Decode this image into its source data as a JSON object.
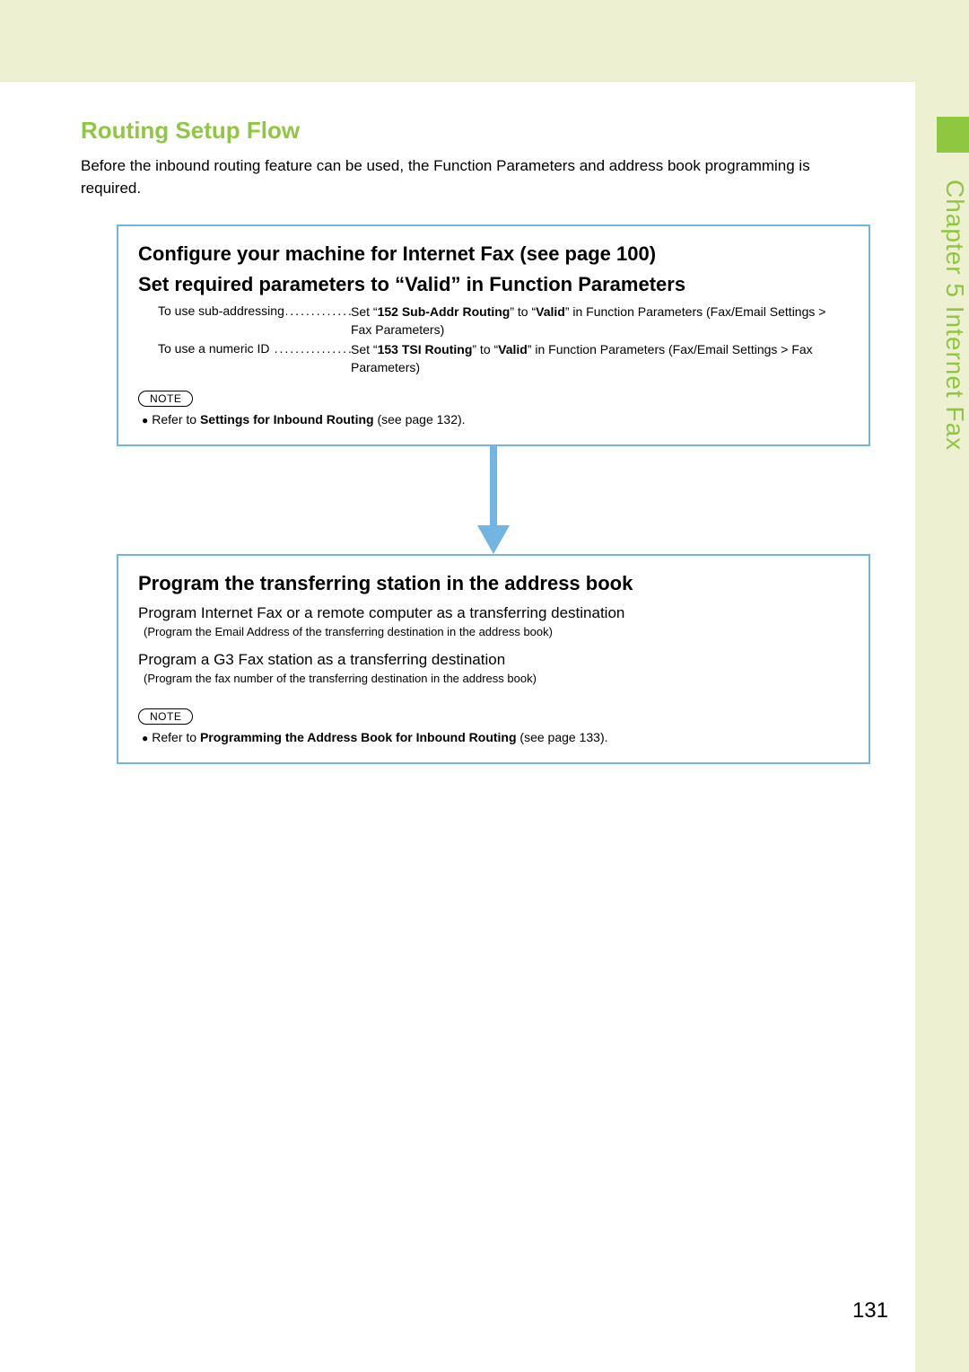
{
  "chapter_label": "Chapter 5   Internet Fax",
  "section_title": "Routing Setup Flow",
  "intro": "Before the inbound routing feature can be used, the Function Parameters and address book programming is required.",
  "box1": {
    "h1": "Configure your machine for Internet Fax (see page 100)",
    "h2": "Set required parameters to “Valid” in Function Parameters",
    "row1_left": "To use sub-addressing",
    "row1_right_pre": "Set “",
    "row1_right_bold": "152 Sub-Addr Routing",
    "row1_right_mid": "” to “",
    "row1_right_bold2": "Valid",
    "row1_right_post": "” in Function Parameters (Fax/Email Settings > Fax Parameters)",
    "row2_left": "To use a numeric ID",
    "row2_right_pre": "Set “",
    "row2_right_bold": "153 TSI Routing",
    "row2_right_mid": "” to “",
    "row2_right_bold2": "Valid",
    "row2_right_post": "” in Function Parameters (Fax/Email Settings > Fax Parameters)",
    "note_label": "NOTE",
    "note_pre": "Refer to ",
    "note_bold": "Settings for Inbound Routing",
    "note_post": " (see page 132)."
  },
  "box2": {
    "h1": "Program the transferring station in the address book",
    "line1": "Program Internet Fax or a remote computer as a transferring destination",
    "sub1": "(Program the Email Address of the transferring destination in the address book)",
    "line2": "Program a G3 Fax station as a transferring destination",
    "sub2": "(Program the fax number of the transferring destination in the address book)",
    "note_label": "NOTE",
    "note_pre": "Refer to ",
    "note_bold": "Programming the Address Book for Inbound Routing",
    "note_post": " (see page 133)."
  },
  "page_number": "131"
}
